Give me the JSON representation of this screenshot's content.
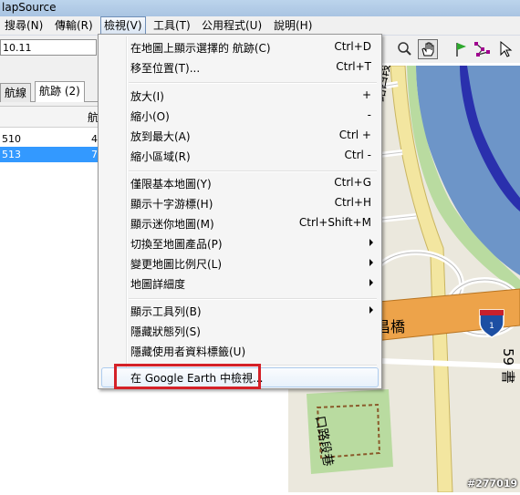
{
  "window": {
    "title": "lapSource"
  },
  "menubar": {
    "items": [
      "搜尋(N)",
      "傳輸(R)",
      "檢視(V)",
      "工具(T)",
      "公用程式(U)",
      "說明(H)"
    ]
  },
  "toolbar": {
    "combo_value": "10.11"
  },
  "left_pane": {
    "tabs": [
      "航線",
      "航跡 (2)"
    ],
    "column_header": "航",
    "rows": [
      {
        "name": "510",
        "value": "4"
      },
      {
        "name": "513",
        "value": "7"
      }
    ]
  },
  "view_menu": {
    "groups": [
      [
        {
          "label": "在地圖上顯示選擇的 航跡(C)",
          "shortcut": "Ctrl+D"
        },
        {
          "label": "移至位置(T)...",
          "shortcut": "Ctrl+T"
        }
      ],
      [
        {
          "label": "放大(I)",
          "shortcut": "+"
        },
        {
          "label": "縮小(O)",
          "shortcut": "-"
        },
        {
          "label": "放到最大(A)",
          "shortcut": "Ctrl +"
        },
        {
          "label": "縮小區域(R)",
          "shortcut": "Ctrl -"
        }
      ],
      [
        {
          "label": "僅限基本地圖(Y)",
          "shortcut": "Ctrl+G"
        },
        {
          "label": "顯示十字游標(H)",
          "shortcut": "Ctrl+H"
        },
        {
          "label": "顯示迷你地圖(M)",
          "shortcut": "Ctrl+Shift+M"
        },
        {
          "label": "切換至地圖產品(P)",
          "shortcut": ""
        },
        {
          "label": "變更地圖比例尺(L)",
          "shortcut": ""
        },
        {
          "label": "地圖詳細度",
          "shortcut": ""
        }
      ],
      [
        {
          "label": "顯示工具列(B)",
          "shortcut": ""
        },
        {
          "label": "隱藏狀態列(S)",
          "shortcut": ""
        },
        {
          "label": "隱藏使用者資料標籤(U)",
          "shortcut": ""
        }
      ],
      [
        {
          "label": "在 Google Earth 中檢視...",
          "shortcut": ""
        }
      ]
    ]
  },
  "map": {
    "road_labels": [
      "路四段",
      "慶昌橋",
      "59 書",
      "口路段巷"
    ],
    "shield_number": "1",
    "watermark": "#277019"
  },
  "colors": {
    "river": "#6d95c8",
    "highway": "#eda34a",
    "road_yellow": "#f3e6a0",
    "park": "#b9dba0",
    "highlight_border": "#d42128",
    "selection": "#3399ff"
  }
}
